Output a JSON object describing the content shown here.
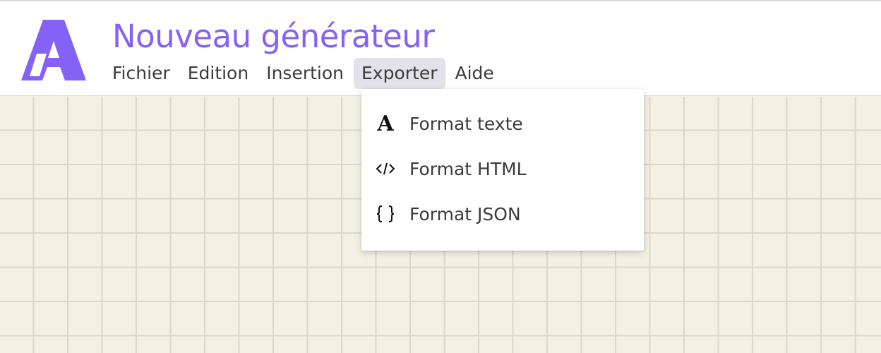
{
  "app": {
    "title": "Nouveau générateur",
    "accent_color": "#8462f5",
    "logo_icon": "stylized-a-logo-icon"
  },
  "menubar": {
    "items": [
      {
        "label": "Fichier"
      },
      {
        "label": "Edition"
      },
      {
        "label": "Insertion"
      },
      {
        "label": "Exporter",
        "active": true
      },
      {
        "label": "Aide"
      }
    ]
  },
  "export_menu": {
    "items": [
      {
        "label": "Format texte",
        "icon": "serif-a-icon"
      },
      {
        "label": "Format HTML",
        "icon": "code-tag-icon"
      },
      {
        "label": "Format JSON",
        "icon": "curly-braces-icon"
      }
    ]
  }
}
